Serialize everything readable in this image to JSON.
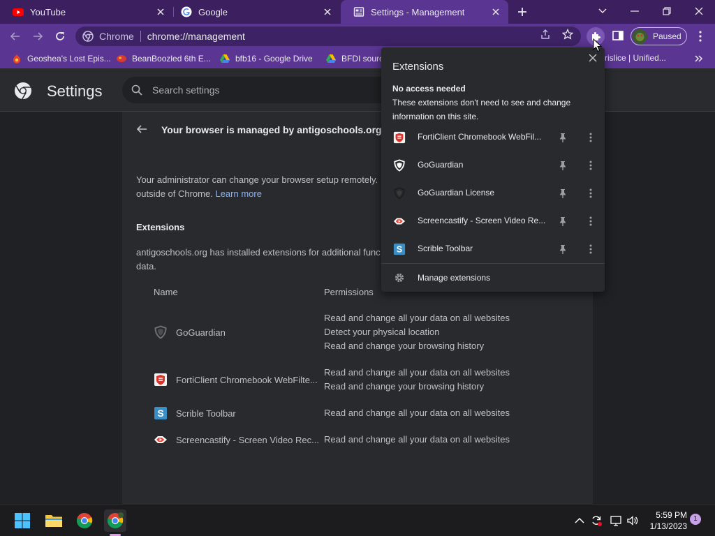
{
  "tabs": [
    {
      "title": "YouTube",
      "icon": "youtube-icon",
      "active": false
    },
    {
      "title": "Google",
      "icon": "google-icon",
      "active": false
    },
    {
      "title": "Settings - Management",
      "icon": "settings-page-icon",
      "active": true
    }
  ],
  "toolbar": {
    "chip": "Chrome",
    "url": "chrome://management",
    "profile_status": "Paused"
  },
  "bookmarks": [
    {
      "label": "Geoshea's Lost Epis...",
      "icon": "bookmark-favicon-icon"
    },
    {
      "label": "BeanBoozled 6th E...",
      "icon": "bookmark-favicon-icon"
    },
    {
      "label": "bfb16 - Google Drive",
      "icon": "google-drive-icon"
    },
    {
      "label": "BFDI sourc",
      "icon": "google-drive-icon"
    }
  ],
  "bookmark_right": "rislice | Unified...",
  "settings": {
    "title": "Settings",
    "search_placeholder": "Search settings"
  },
  "management": {
    "title": "Your browser is managed by antigoschools.org",
    "admin_text": "Your administrator can change your browser setup remotely.",
    "admin_text2": "outside of Chrome.",
    "learn_more": "Learn more",
    "extensions_heading": "Extensions",
    "extensions_desc": "antigoschools.org has installed extensions for additional func",
    "extensions_desc2": "data.",
    "col_name": "Name",
    "col_permissions": "Permissions",
    "rows": [
      {
        "name": "GoGuardian",
        "permissions": [
          "Read and change all your data on all websites",
          "Detect your physical location",
          "Read and change your browsing history"
        ]
      },
      {
        "name": "FortiClient Chromebook WebFilte...",
        "permissions": [
          "Read and change all your data on all websites",
          "Read and change your browsing history"
        ]
      },
      {
        "name": "Scrible Toolbar",
        "permissions": [
          "Read and change all your data on all websites"
        ]
      },
      {
        "name": "Screencastify - Screen Video Rec...",
        "permissions": [
          "Read and change all your data on all websites"
        ]
      }
    ]
  },
  "popup": {
    "title": "Extensions",
    "subtitle": "No access needed",
    "desc": "These extensions don't need to see and change information on this site.",
    "items": [
      {
        "name": "FortiClient Chromebook WebFil...",
        "icon": "forticlient-icon"
      },
      {
        "name": "GoGuardian",
        "icon": "goguardian-icon"
      },
      {
        "name": "GoGuardian License",
        "icon": "goguardian-license-icon"
      },
      {
        "name": "Screencastify - Screen Video Re...",
        "icon": "screencastify-icon"
      },
      {
        "name": "Scrible Toolbar",
        "icon": "scrible-icon"
      }
    ],
    "manage": "Manage extensions"
  },
  "taskbar": {
    "time": "5:59 PM",
    "date": "1/13/2023",
    "notifications": "1"
  },
  "colors": {
    "frame": "#3b1f5e",
    "toolbar": "#5b3592",
    "accent_link": "#8ab4f8",
    "background": "#202124",
    "card": "#292a2d"
  }
}
